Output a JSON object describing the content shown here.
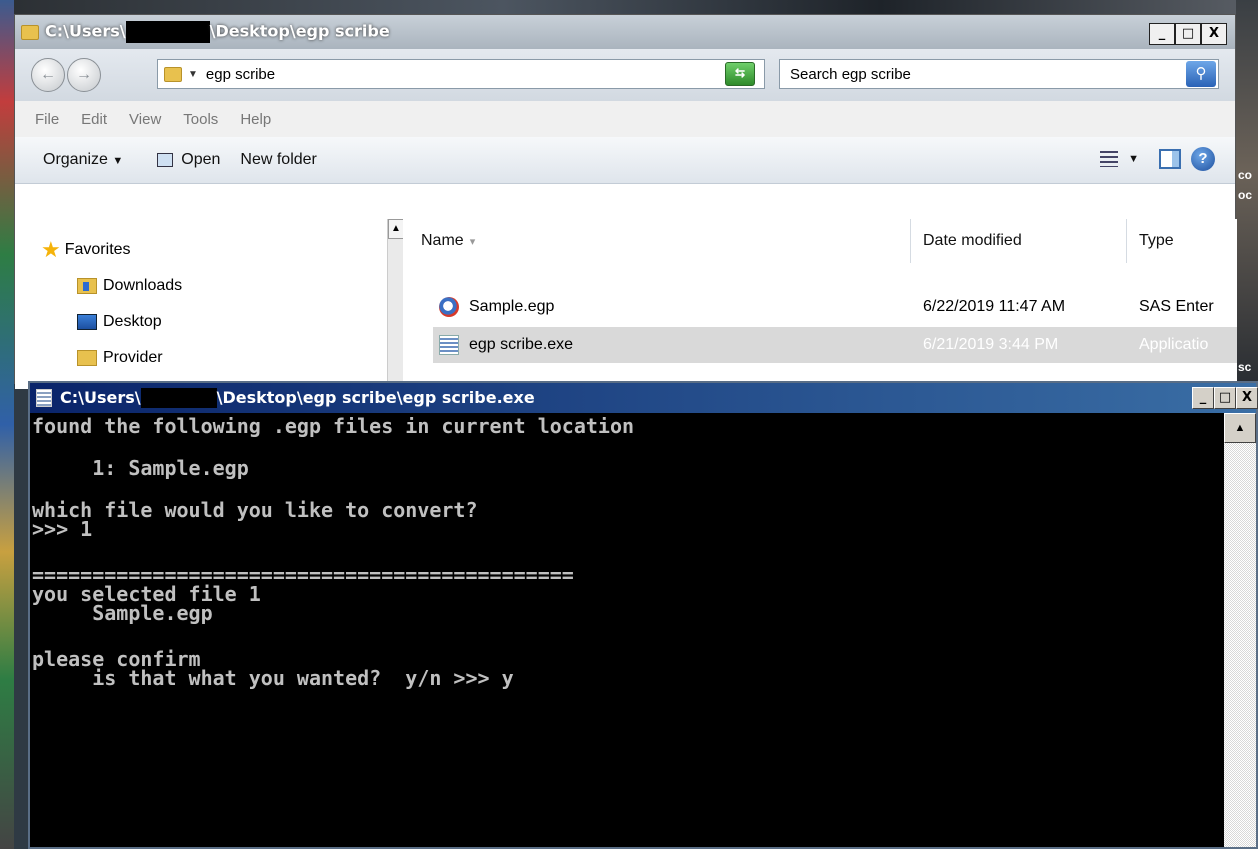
{
  "explorer": {
    "title_prefix": "C:\\Users\\",
    "title_suffix": "\\Desktop\\egp scribe",
    "address": "egp scribe",
    "search_placeholder": "Search egp scribe",
    "menu": [
      "File",
      "Edit",
      "View",
      "Tools",
      "Help"
    ],
    "toolbar": {
      "organize": "Organize",
      "open": "Open",
      "new_folder": "New folder"
    },
    "nav": {
      "favorites": "Favorites",
      "items": [
        "Downloads",
        "Desktop",
        "Provider"
      ]
    },
    "columns": {
      "name": "Name",
      "date": "Date modified",
      "type": "Type"
    },
    "files": [
      {
        "name": "Sample.egp",
        "date": "6/22/2019 11:47 AM",
        "type": "SAS Enter"
      },
      {
        "name": "egp scribe.exe",
        "date": "6/21/2019 3:44 PM",
        "type": "Applicatio"
      }
    ],
    "window_buttons": {
      "minimize": "_",
      "maximize": "□",
      "close": "X"
    }
  },
  "console": {
    "title_prefix": "C:\\Users\\",
    "title_suffix": "\\Desktop\\egp scribe\\egp scribe.exe",
    "lines": [
      "found the following .egp files in current location",
      "",
      "     1: Sample.egp",
      "",
      "which file would you like to convert?",
      ">>> 1",
      "",
      "=============================================",
      "you selected file 1",
      "     Sample.egp",
      "",
      "please confirm",
      "     is that what you wanted?  y/n >>> y"
    ],
    "window_buttons": {
      "minimize": "_",
      "maximize": "□",
      "close": "X"
    }
  },
  "desktop_fragments": [
    "co",
    "oc",
    "sc"
  ]
}
